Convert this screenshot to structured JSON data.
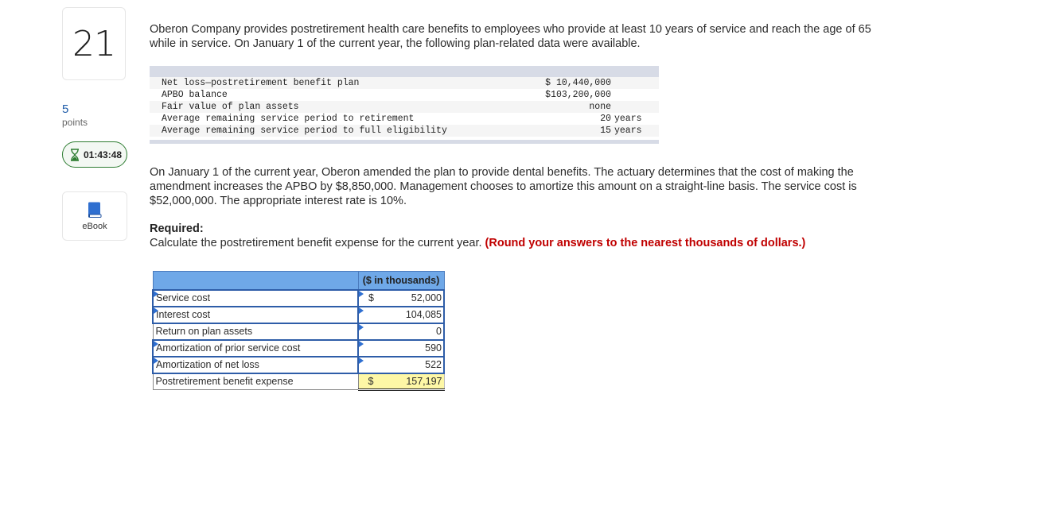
{
  "question": {
    "number": "21",
    "points_value": "5",
    "points_label": "points",
    "timer": "01:43:48",
    "ebook_label": "eBook"
  },
  "intro_text": "Oberon Company provides postretirement health care benefits to employees who provide at least 10 years of service and reach the age of 65 while in service. On January 1 of the current year, the following plan-related data were available.",
  "given_data": [
    {
      "label": "Net loss—postretirement benefit plan",
      "value": "$ 10,440,000",
      "unit": ""
    },
    {
      "label": "APBO balance",
      "value": "$103,200,000",
      "unit": ""
    },
    {
      "label": "Fair value of plan assets",
      "value": "none",
      "unit": ""
    },
    {
      "label": "Average remaining service period to retirement",
      "value": "20",
      "unit": "years"
    },
    {
      "label": "Average remaining service period to full eligibility",
      "value": "15",
      "unit": "years"
    }
  ],
  "amendment_text": "On January 1 of the current year, Oberon amended the plan to provide dental benefits. The actuary determines that the cost of making the amendment increases the APBO by $8,850,000. Management chooses to amortize this amount on a straight-line basis. The service cost is $52,000,000. The appropriate interest rate is 10%.",
  "required": {
    "title": "Required:",
    "text": "Calculate the postretirement benefit expense for the current year.",
    "instruction": "(Round your answers to the nearest thousands of dollars.)"
  },
  "answer_table": {
    "column_header": "($ in thousands)",
    "rows": [
      {
        "label": "Service cost",
        "currency": "$",
        "value": "52,000"
      },
      {
        "label": "Interest cost",
        "currency": "",
        "value": "104,085"
      },
      {
        "label": "Return on plan assets",
        "currency": "",
        "value": "0"
      },
      {
        "label": "Amortization of prior service cost",
        "currency": "",
        "value": "590"
      },
      {
        "label": "Amortization of net loss",
        "currency": "",
        "value": "522"
      },
      {
        "label": "Postretirement benefit expense",
        "currency": "$",
        "value": "157,197"
      }
    ]
  },
  "colors": {
    "header_blue": "#6fa8e8",
    "input_border": "#2e5da8",
    "total_highlight": "#fdf7a6",
    "instruction_red": "#c00000",
    "timer_green": "#2e7d32",
    "points_blue": "#1e5ba8"
  }
}
